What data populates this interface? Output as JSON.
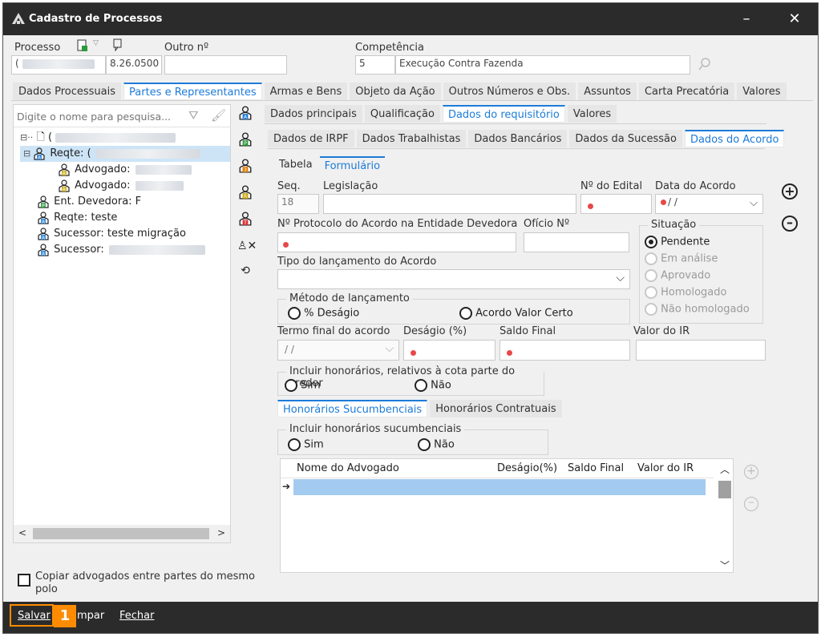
{
  "window": {
    "title": "Cadastro de Processos"
  },
  "header": {
    "processo_label": "Processo",
    "processo_prefix": "(",
    "processo_number": "8.26.0500",
    "outro_label": "Outro nº",
    "outro_value": "",
    "competencia_label": "Competência",
    "competencia_code": "5",
    "competencia_desc": "Execução Contra Fazenda"
  },
  "main_tabs": [
    {
      "label": "Dados Processuais",
      "active": false
    },
    {
      "label": "Partes e Representantes",
      "active": true
    },
    {
      "label": "Armas e Bens",
      "active": false
    },
    {
      "label": "Objeto da Ação",
      "active": false
    },
    {
      "label": "Outros Números e Obs.",
      "active": false
    },
    {
      "label": "Assuntos",
      "active": false
    },
    {
      "label": "Carta Precatória",
      "active": false
    },
    {
      "label": "Valores",
      "active": false
    }
  ],
  "search": {
    "placeholder": "Digite o nome para pesquisa..."
  },
  "tree": {
    "root": "(",
    "items": [
      {
        "label": "Reqte: (",
        "badge": "A",
        "level": 1,
        "selected": true
      },
      {
        "label": "Advogado:",
        "badge": "R",
        "level": 2
      },
      {
        "label": "Advogado:",
        "badge": "R",
        "level": 2
      },
      {
        "label": "Ent. Devedora: F",
        "badge": "P",
        "level": 1
      },
      {
        "label": "Reqte: teste",
        "badge": "A",
        "level": 1
      },
      {
        "label": "Sucessor: teste  migração",
        "badge": "A",
        "level": 1
      },
      {
        "label": "Sucessor:",
        "badge": "A",
        "level": 1
      }
    ]
  },
  "copy_checkbox": {
    "label": "Copiar advogados entre partes do mesmo polo"
  },
  "sub_tabs": [
    {
      "label": "Dados principais",
      "active": false
    },
    {
      "label": "Qualificação",
      "active": false
    },
    {
      "label": "Dados do requisitório",
      "active": true
    },
    {
      "label": "Valores",
      "active": false
    }
  ],
  "third_tabs": [
    {
      "label": "Dados de IRPF",
      "active": false
    },
    {
      "label": "Dados Trabalhistas",
      "active": false
    },
    {
      "label": "Dados Bancários",
      "active": false
    },
    {
      "label": "Dados da Sucessão",
      "active": false
    },
    {
      "label": "Dados do Acordo",
      "active": true
    }
  ],
  "view_tabs": [
    {
      "label": "Tabela",
      "active": false
    },
    {
      "label": "Formulário",
      "active": true
    }
  ],
  "form": {
    "seq_label": "Seq.",
    "seq_value": "18",
    "legislacao_label": "Legislação",
    "edital_label": "Nº do Edital",
    "data_acordo_label": "Data do Acordo",
    "data_acordo_value": "/ /",
    "protocolo_label": "Nº Protocolo do Acordo na Entidade Devedora",
    "oficio_label": "Ofício Nº",
    "situacao_label": "Situação",
    "situacao_options": [
      {
        "label": "Pendente",
        "checked": true,
        "enabled": true
      },
      {
        "label": "Em análise",
        "checked": false,
        "enabled": false
      },
      {
        "label": "Aprovado",
        "checked": false,
        "enabled": false
      },
      {
        "label": "Homologado",
        "checked": false,
        "enabled": false
      },
      {
        "label": "Não homologado",
        "checked": false,
        "enabled": false
      }
    ],
    "tipo_label": "Tipo do lançamento do Acordo",
    "metodo_label": "Método de lançamento",
    "metodo_opt1": "% Deságio",
    "metodo_opt2": "Acordo Valor Certo",
    "termo_label": "Termo final do acordo",
    "termo_value": "/ /",
    "desagio_label": "Deságio (%)",
    "saldo_label": "Saldo Final",
    "valor_ir_label": "Valor do IR",
    "incluir_hon_label": "Incluir honorários, relativos à cota parte do credor",
    "sim": "Sim",
    "nao": "Não"
  },
  "hon_tabs": [
    {
      "label": "Honorários Sucumbenciais",
      "active": true
    },
    {
      "label": "Honorários Contratuais",
      "active": false
    }
  ],
  "sucumb": {
    "label": "Incluir honorários sucumbenciais",
    "sim": "Sim",
    "nao": "Não"
  },
  "grid": {
    "columns": [
      "Nome do Advogado",
      "Deságio(%)",
      "Saldo Final",
      "Valor do IR"
    ]
  },
  "footer": {
    "salvar": "Salvar",
    "badge": "1",
    "limpar": "mpar",
    "fechar": "Fechar"
  },
  "colors": {
    "accent": "#1d7bd8",
    "titlebar": "#2b2b2b",
    "highlight": "#ff8c00",
    "required": "#e84848",
    "grid_row": "#a3cbf0"
  }
}
